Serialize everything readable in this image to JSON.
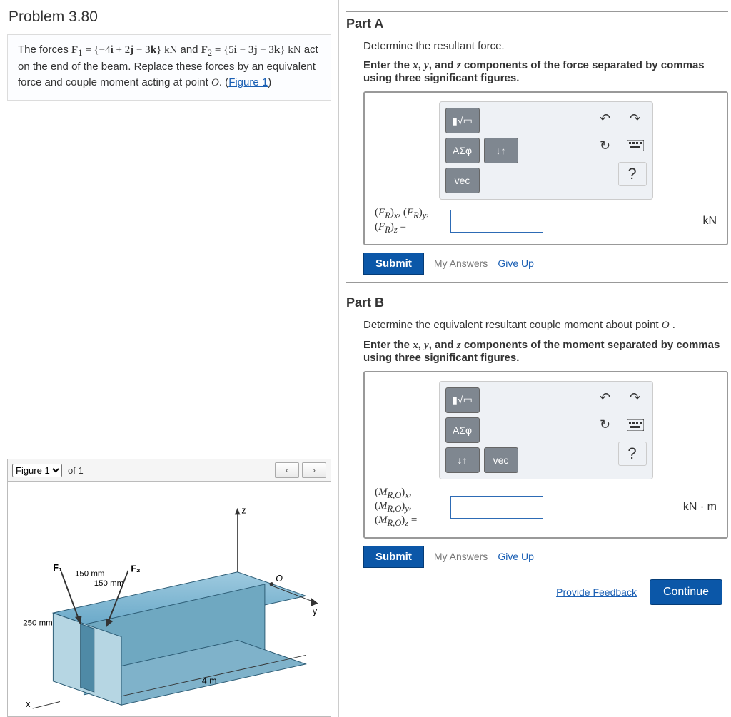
{
  "problem": {
    "title": "Problem 3.80",
    "prompt_html": "The forces <span class='math'><b>F</b><sub>1</sub> = {−4<b>i</b> + 2<b>j</b> − 3<b>k</b>} kN</span> and <span class='math'><b>F</b><sub>2</sub> = {5<b>i</b> − 3<b>j</b> − 3<b>k</b>} kN</span> act on the end of the beam. Replace these forces by an equivalent force and couple moment acting at point <span class='math'><i>O</i></span>. (",
    "figure_link": "Figure 1",
    "prompt_end": ")"
  },
  "figure": {
    "selector_label": "Figure 1",
    "of_text": "of 1",
    "prev": "‹",
    "next": "›",
    "labels": {
      "F1": "F₁",
      "F2": "F₂",
      "d1": "150 mm",
      "d2": "150 mm",
      "d3": "250 mm",
      "len": "4 m",
      "x": "x",
      "y": "y",
      "z": "z",
      "O": "O"
    }
  },
  "partA": {
    "header": "Part A",
    "desc": "Determine the resultant force.",
    "inst_html": "<b>Enter the <span class='math'><i>x</i></span>, <span class='math'><i>y</i></span>, and <span class='math'><i>z</i></span> components of the force separated by commas using three significant figures.</b>",
    "var_html": "(<i>F<sub>R</sub></i>)<sub><i>x</i></sub>, (<i>F<sub>R</sub></i>)<sub><i>y</i></sub>, (<i>F<sub>R</sub></i>)<sub><i>z</i></sub> =",
    "unit": "kN",
    "toolbar": {
      "templates": "▮√▭",
      "greek": "ΑΣφ",
      "updown": "↓↑",
      "vec": "vec",
      "undo": "↶",
      "redo": "↷",
      "reset": "↻",
      "kb": "⌨",
      "help": "?"
    },
    "submit": "Submit",
    "myanswers": "My Answers",
    "giveup": "Give Up"
  },
  "partB": {
    "header": "Part B",
    "desc_html": "Determine the equivalent resultant couple moment about point <span class='math'><i>O</i></span> .",
    "inst_html": "<b>Enter the <span class='math'><i>x</i></span>, <span class='math'><i>y</i></span>, and <span class='math'><i>z</i></span> components of the moment separated by commas using three significant figures.</b>",
    "var_html": "(<i>M<sub>R,O</sub></i>)<sub><i>x</i></sub>, (<i>M<sub>R,O</sub></i>)<sub><i>y</i></sub>, (<i>M<sub>R,O</sub></i>)<sub><i>z</i></sub> =",
    "unit": "kN · m",
    "toolbar": {
      "templates": "▮√▭",
      "greek": "ΑΣφ",
      "updown": "↓↑",
      "vec": "vec",
      "undo": "↶",
      "redo": "↷",
      "reset": "↻",
      "kb": "⌨",
      "help": "?"
    },
    "submit": "Submit",
    "myanswers": "My Answers",
    "giveup": "Give Up"
  },
  "footer": {
    "feedback": "Provide Feedback",
    "continue": "Continue"
  }
}
